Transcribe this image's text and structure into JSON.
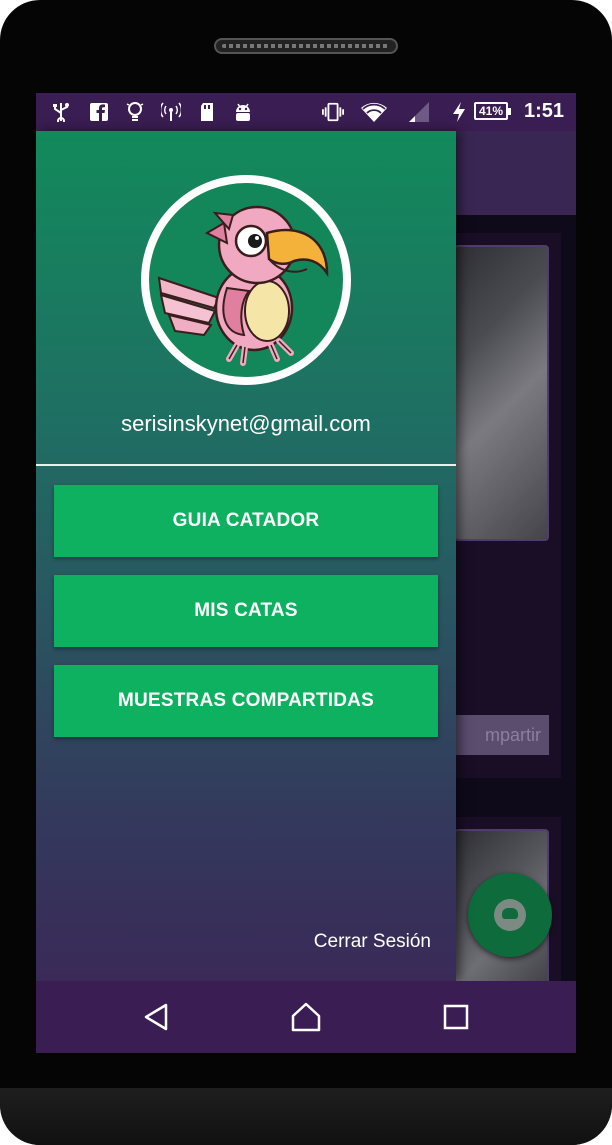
{
  "status_bar": {
    "time": "1:51",
    "battery_percent": "41%",
    "icons": [
      "usb-icon",
      "facebook-icon",
      "lightbulb-icon",
      "hotspot-icon",
      "storage-icon",
      "android-icon",
      "vibrate-icon",
      "wifi-icon",
      "cell-signal-icon",
      "charging-icon"
    ]
  },
  "drawer": {
    "email": "serisinskynet@gmail.com",
    "menu": [
      {
        "label": "GUIA CATADOR"
      },
      {
        "label": "MIS CATAS"
      },
      {
        "label": "MUESTRAS COMPARTIDAS"
      }
    ],
    "logout_label": "Cerrar Sesión"
  },
  "background": {
    "share_button_label": "mpartir"
  },
  "nav_bar": {
    "buttons": [
      "back-icon",
      "home-icon",
      "recents-icon"
    ]
  },
  "colors": {
    "status_bar": "#3a1d52",
    "drawer_top": "#128a5b",
    "drawer_bottom": "#3a2a58",
    "menu_button": "#0db160",
    "fab": "#0d6b3c"
  }
}
